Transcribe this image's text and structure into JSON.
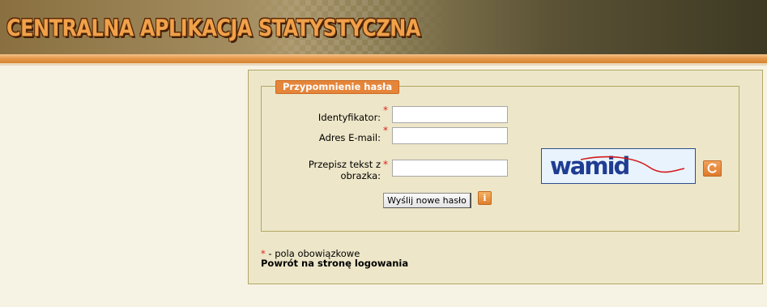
{
  "header": {
    "title": "CENTRALNA APLIKACJA STATYSTYCZNA"
  },
  "form": {
    "legend": "Przypomnienie hasła",
    "required_marker": "*",
    "fields": {
      "identifier": {
        "label": "Identyfikator:",
        "value": "",
        "placeholder": ""
      },
      "email": {
        "label": "Adres E-mail:",
        "value": "",
        "placeholder": ""
      },
      "captcha_text": {
        "label_line1": "Przepisz tekst z",
        "label_line2": "obrazka:",
        "value": "",
        "placeholder": ""
      }
    },
    "captcha_image_text": "wamid",
    "submit_label": "Wyślij nowe hasło",
    "info_icon_glyph": "i",
    "refresh_icon": "refresh-icon"
  },
  "footer": {
    "required_star": "*",
    "required_note": " - pola obowiązkowe",
    "back_link": "Powrót na stronę logowania"
  },
  "colors": {
    "accent_orange": "#e5853a",
    "panel_bg": "#ede6c8",
    "panel_border": "#b2a664",
    "required_red": "#e02020",
    "captcha_text": "#1f3d92",
    "captcha_line": "#d21a1a"
  }
}
